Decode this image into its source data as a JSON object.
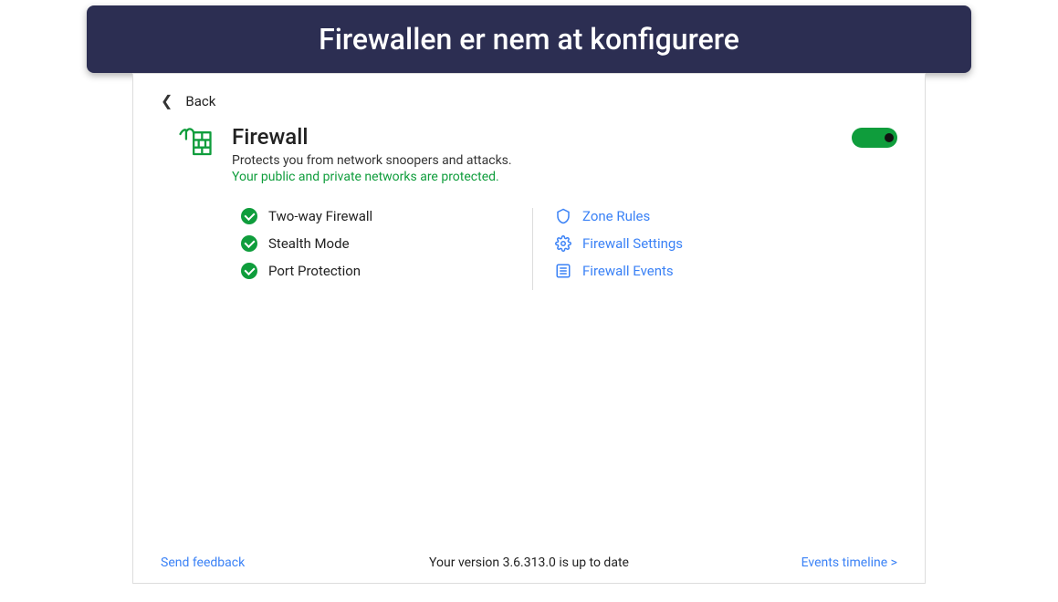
{
  "banner": {
    "text": "Firewallen er nem at konfigurere"
  },
  "nav": {
    "back_label": "Back"
  },
  "header": {
    "title": "Firewall",
    "subtitle": "Protects you from network snoopers and attacks.",
    "status": "Your public and private networks are protected."
  },
  "toggle": {
    "enabled": true
  },
  "features": [
    {
      "label": "Two-way Firewall"
    },
    {
      "label": "Stealth Mode"
    },
    {
      "label": "Port Protection"
    }
  ],
  "links": [
    {
      "label": "Zone Rules",
      "icon": "shield"
    },
    {
      "label": "Firewall Settings",
      "icon": "gear"
    },
    {
      "label": "Firewall Events",
      "icon": "list"
    }
  ],
  "footer": {
    "feedback": "Send feedback",
    "version": "Your version 3.6.313.0 is up to date",
    "timeline": "Events timeline >"
  },
  "colors": {
    "green": "#0f9d3c",
    "blue": "#3b82f6",
    "banner": "#2c2e52"
  }
}
